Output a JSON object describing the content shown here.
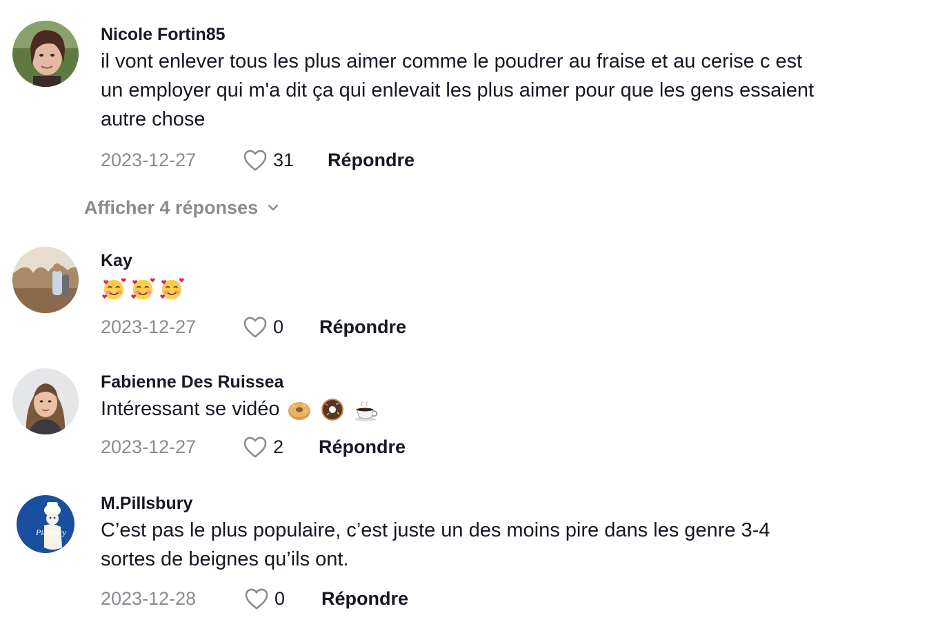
{
  "comments": [
    {
      "username": "Nicole Fortin85",
      "lines": [
        "il vont enlever tous les plus aimer comme le poudrer au fraise et au cerise c est",
        "un employer qui m'a dit ça qui enlevait les plus aimer pour que les gens essaient",
        "autre chose"
      ],
      "date": "2023-12-27",
      "likes": "31",
      "reply_label": "Répondre",
      "avatar_icon": "woman-outdoor-photo"
    },
    {
      "username": "Kay",
      "emojis": [
        "smiling-face-with-hearts-icon",
        "smiling-face-with-hearts-icon",
        "smiling-face-with-hearts-icon"
      ],
      "date": "2023-12-27",
      "likes": "0",
      "reply_label": "Répondre",
      "avatar_icon": "couple-in-field-photo"
    },
    {
      "username": "Fabienne Des Ruissea",
      "text": "Intéressant se vidéo",
      "emojis": [
        "bagel-icon",
        "doughnut-icon",
        "hot-beverage-icon"
      ],
      "date": "2023-12-27",
      "likes": "2",
      "reply_label": "Répondre",
      "avatar_icon": "woman-portrait-photo"
    },
    {
      "username": "M.Pillsbury",
      "lines": [
        "C’est pas le plus populaire, c’est juste un des moins pire dans les genre 3-4",
        "sortes de beignes qu’ils ont."
      ],
      "date": "2023-12-28",
      "likes": "0",
      "reply_label": "Répondre",
      "avatar_icon": "pillsbury-logo",
      "avatar_logo_text": "Pillsbury"
    }
  ],
  "view_replies": {
    "label": "Afficher 4 réponses",
    "icon": "chevron-down-icon"
  },
  "colors": {
    "text": "#161823",
    "muted": "#8a8b91",
    "pillsbury_blue": "#1a4fa0"
  }
}
